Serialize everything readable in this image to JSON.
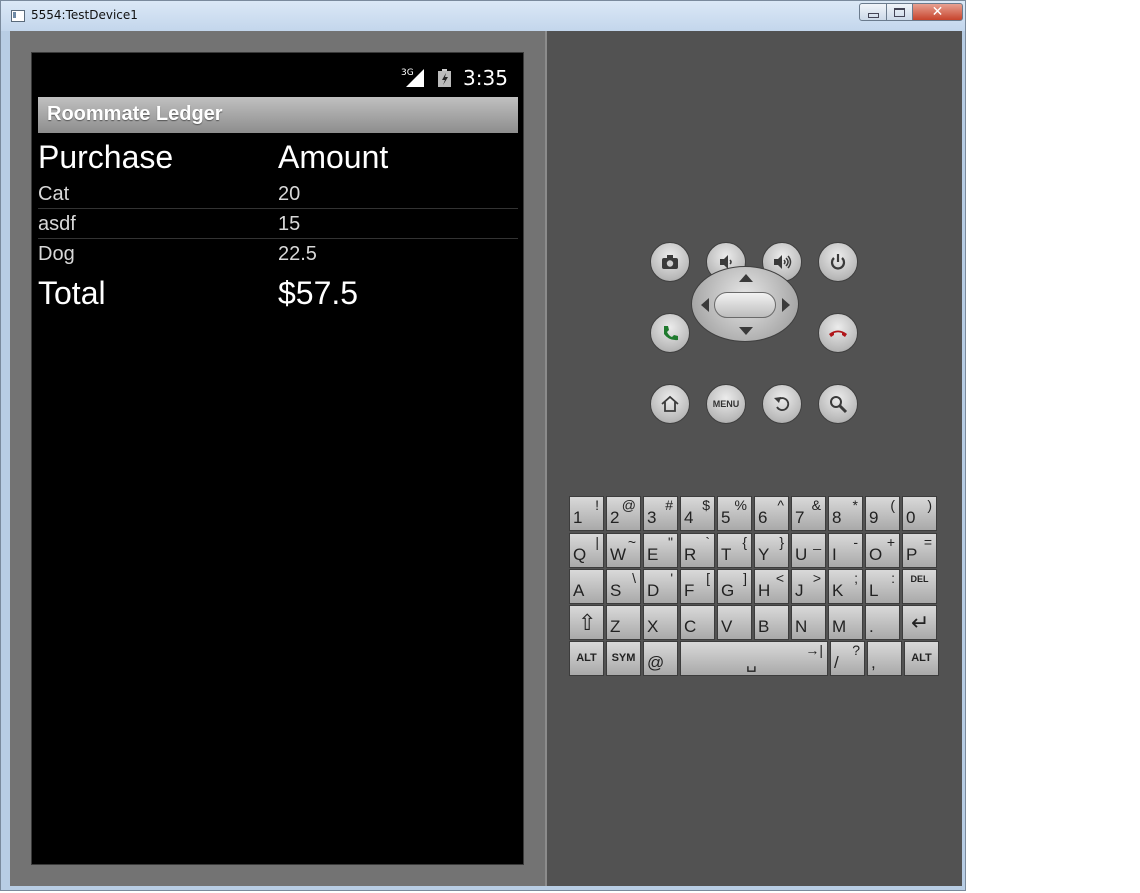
{
  "window": {
    "title": "5554:TestDevice1",
    "close_glyph": "✕"
  },
  "status_bar": {
    "network": "3G",
    "time": "3:35"
  },
  "app": {
    "title": "Roommate Ledger",
    "columns": [
      "Purchase",
      "Amount"
    ],
    "rows": [
      {
        "purchase": "Cat",
        "amount": "20"
      },
      {
        "purchase": "asdf",
        "amount": "15"
      },
      {
        "purchase": "Dog",
        "amount": "22.5"
      }
    ],
    "total_label": "Total",
    "total_value": "$57.5"
  },
  "controls": {
    "menu_label": "MENU",
    "icons": [
      "camera-icon",
      "volume-down-icon",
      "volume-up-icon",
      "power-icon",
      "call-icon",
      "end-call-icon",
      "home-icon",
      "menu-icon",
      "back-icon",
      "search-icon"
    ]
  },
  "keyboard": {
    "rows": [
      [
        {
          "m": "1",
          "a": "!"
        },
        {
          "m": "2",
          "a": "@"
        },
        {
          "m": "3",
          "a": "#"
        },
        {
          "m": "4",
          "a": "$"
        },
        {
          "m": "5",
          "a": "%"
        },
        {
          "m": "6",
          "a": "^"
        },
        {
          "m": "7",
          "a": "&"
        },
        {
          "m": "8",
          "a": "*"
        },
        {
          "m": "9",
          "a": "("
        },
        {
          "m": "0",
          "a": ")"
        }
      ],
      [
        {
          "m": "Q",
          "a": "|"
        },
        {
          "m": "W",
          "a": "~"
        },
        {
          "m": "E",
          "a": "\""
        },
        {
          "m": "R",
          "a": "`"
        },
        {
          "m": "T",
          "a": "{"
        },
        {
          "m": "Y",
          "a": "}"
        },
        {
          "m": "U",
          "a": "_"
        },
        {
          "m": "I",
          "a": "-"
        },
        {
          "m": "O",
          "a": "+"
        },
        {
          "m": "P",
          "a": "="
        }
      ],
      [
        {
          "m": "A",
          "a": ""
        },
        {
          "m": "S",
          "a": "\\"
        },
        {
          "m": "D",
          "a": "'"
        },
        {
          "m": "F",
          "a": "["
        },
        {
          "m": "G",
          "a": "]"
        },
        {
          "m": "H",
          "a": "<"
        },
        {
          "m": "J",
          "a": ">"
        },
        {
          "m": "K",
          "a": ";"
        },
        {
          "m": "L",
          "a": ":"
        },
        {
          "m": "DEL",
          "a": ""
        }
      ],
      [
        {
          "m": "⇧",
          "a": ""
        },
        {
          "m": "Z",
          "a": ""
        },
        {
          "m": "X",
          "a": ""
        },
        {
          "m": "C",
          "a": ""
        },
        {
          "m": "V",
          "a": ""
        },
        {
          "m": "B",
          "a": ""
        },
        {
          "m": "N",
          "a": ""
        },
        {
          "m": "M",
          "a": ""
        },
        {
          "m": ".",
          "a": ""
        },
        {
          "m": "↵",
          "a": ""
        }
      ],
      [
        {
          "m": "ALT",
          "a": ""
        },
        {
          "m": "SYM",
          "a": ""
        },
        {
          "m": "@",
          "a": ""
        },
        {
          "m": "␣",
          "a": "→|"
        },
        {
          "m": "/",
          "a": "?"
        },
        {
          "m": ",",
          "a": ""
        },
        {
          "m": "ALT",
          "a": ""
        }
      ]
    ]
  }
}
